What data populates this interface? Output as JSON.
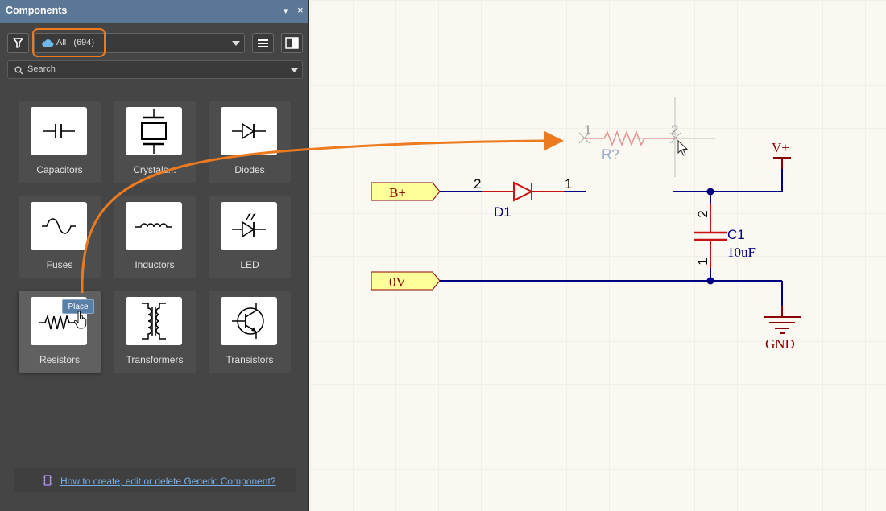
{
  "panel": {
    "title": "Components",
    "header_buttons": [
      "▾",
      "×"
    ],
    "filter": {
      "label": "All",
      "count": "(694)"
    },
    "search": {
      "placeholder": "Search"
    },
    "tiles": [
      {
        "label": "Capacitors",
        "icon": "capacitor-icon"
      },
      {
        "label": "Crystals...",
        "icon": "crystal-icon"
      },
      {
        "label": "Diodes",
        "icon": "diode-icon"
      },
      {
        "label": "Fuses",
        "icon": "fuse-icon"
      },
      {
        "label": "Inductors",
        "icon": "inductor-icon"
      },
      {
        "label": "LED",
        "icon": "led-icon"
      },
      {
        "label": "Resistors",
        "icon": "resistor-icon",
        "selected": true
      },
      {
        "label": "Transformers",
        "icon": "transformer-icon"
      },
      {
        "label": "Transistors",
        "icon": "transistor-icon"
      }
    ],
    "place_tooltip": "Place",
    "help_link": "How to create, edit or delete Generic Component?"
  },
  "schematic": {
    "ports": {
      "bplus": "B+",
      "zero_v": "0V"
    },
    "diode": {
      "designator": "D1",
      "pin_anode": "2",
      "pin_cathode": "1"
    },
    "resistor": {
      "designator": "R?",
      "pin_left": "1",
      "pin_right": "2"
    },
    "capacitor": {
      "designator": "C1",
      "value": "10uF",
      "pin_top": "2",
      "pin_bottom": "1"
    },
    "power": {
      "vplus": "V+",
      "gnd": "GND"
    }
  },
  "colors": {
    "accent_orange": "#ec7a20",
    "panel_header": "#5b7796",
    "wire": "#000080",
    "component_red": "#cc1111",
    "power_dark_red": "#8b0000",
    "port_fill": "#ffff99",
    "grid": "#e7e7e7",
    "link": "#79aee2"
  }
}
